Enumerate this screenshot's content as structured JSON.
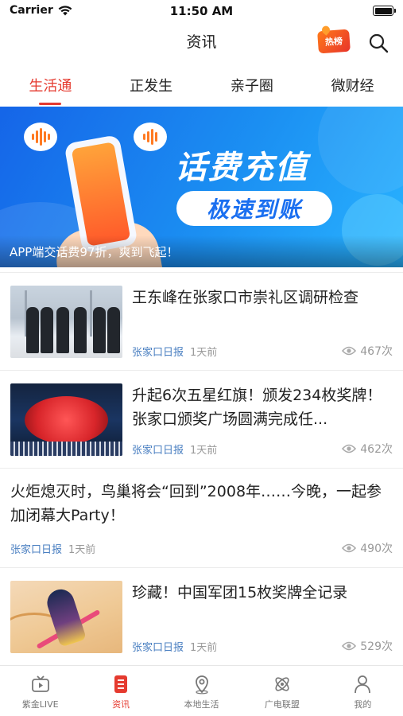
{
  "status_bar": {
    "carrier": "Carrier",
    "time": "11:50 AM",
    "battery_level": 1.0
  },
  "header": {
    "title": "资讯",
    "hot_badge": "热榜",
    "search_icon": "search-icon"
  },
  "tabs": [
    {
      "label": "生活通",
      "active": true
    },
    {
      "label": "正发生",
      "active": false
    },
    {
      "label": "亲子圈",
      "active": false
    },
    {
      "label": "微财经",
      "active": false
    }
  ],
  "banner": {
    "headline": "话费充值",
    "subheadline": "极速到账",
    "caption": "APP端交话费97折，爽到飞起！",
    "colors": {
      "from": "#1565e8",
      "to": "#29b3ff"
    }
  },
  "news": [
    {
      "title": "王东峰在张家口市崇礼区调研检查",
      "source": "张家口日报",
      "time": "1天前",
      "views": "467次",
      "has_image": true
    },
    {
      "title": "升起6次五星红旗！颁发234枚奖牌！张家口颁奖广场圆满完成任...",
      "source": "张家口日报",
      "time": "1天前",
      "views": "462次",
      "has_image": true
    },
    {
      "title": "火炬熄灭时，鸟巢将会“回到”2008年……今晚，一起参加闭幕大Party！",
      "source": "张家口日报",
      "time": "1天前",
      "views": "490次",
      "has_image": false
    },
    {
      "title": "珍藏！中国军团15枚奖牌全记录",
      "source": "张家口日报",
      "time": "1天前",
      "views": "529次",
      "has_image": true
    }
  ],
  "tab_bar": [
    {
      "label": "紫金LIVE",
      "icon": "tv-icon",
      "active": false
    },
    {
      "label": "资讯",
      "icon": "news-icon",
      "active": true
    },
    {
      "label": "本地生活",
      "icon": "location-icon",
      "active": false
    },
    {
      "label": "广电联盟",
      "icon": "atom-icon",
      "active": false
    },
    {
      "label": "我的",
      "icon": "user-icon",
      "active": false
    }
  ],
  "colors": {
    "accent": "#e53a2f",
    "source_link": "#4a7fc1",
    "meta": "#999999"
  }
}
